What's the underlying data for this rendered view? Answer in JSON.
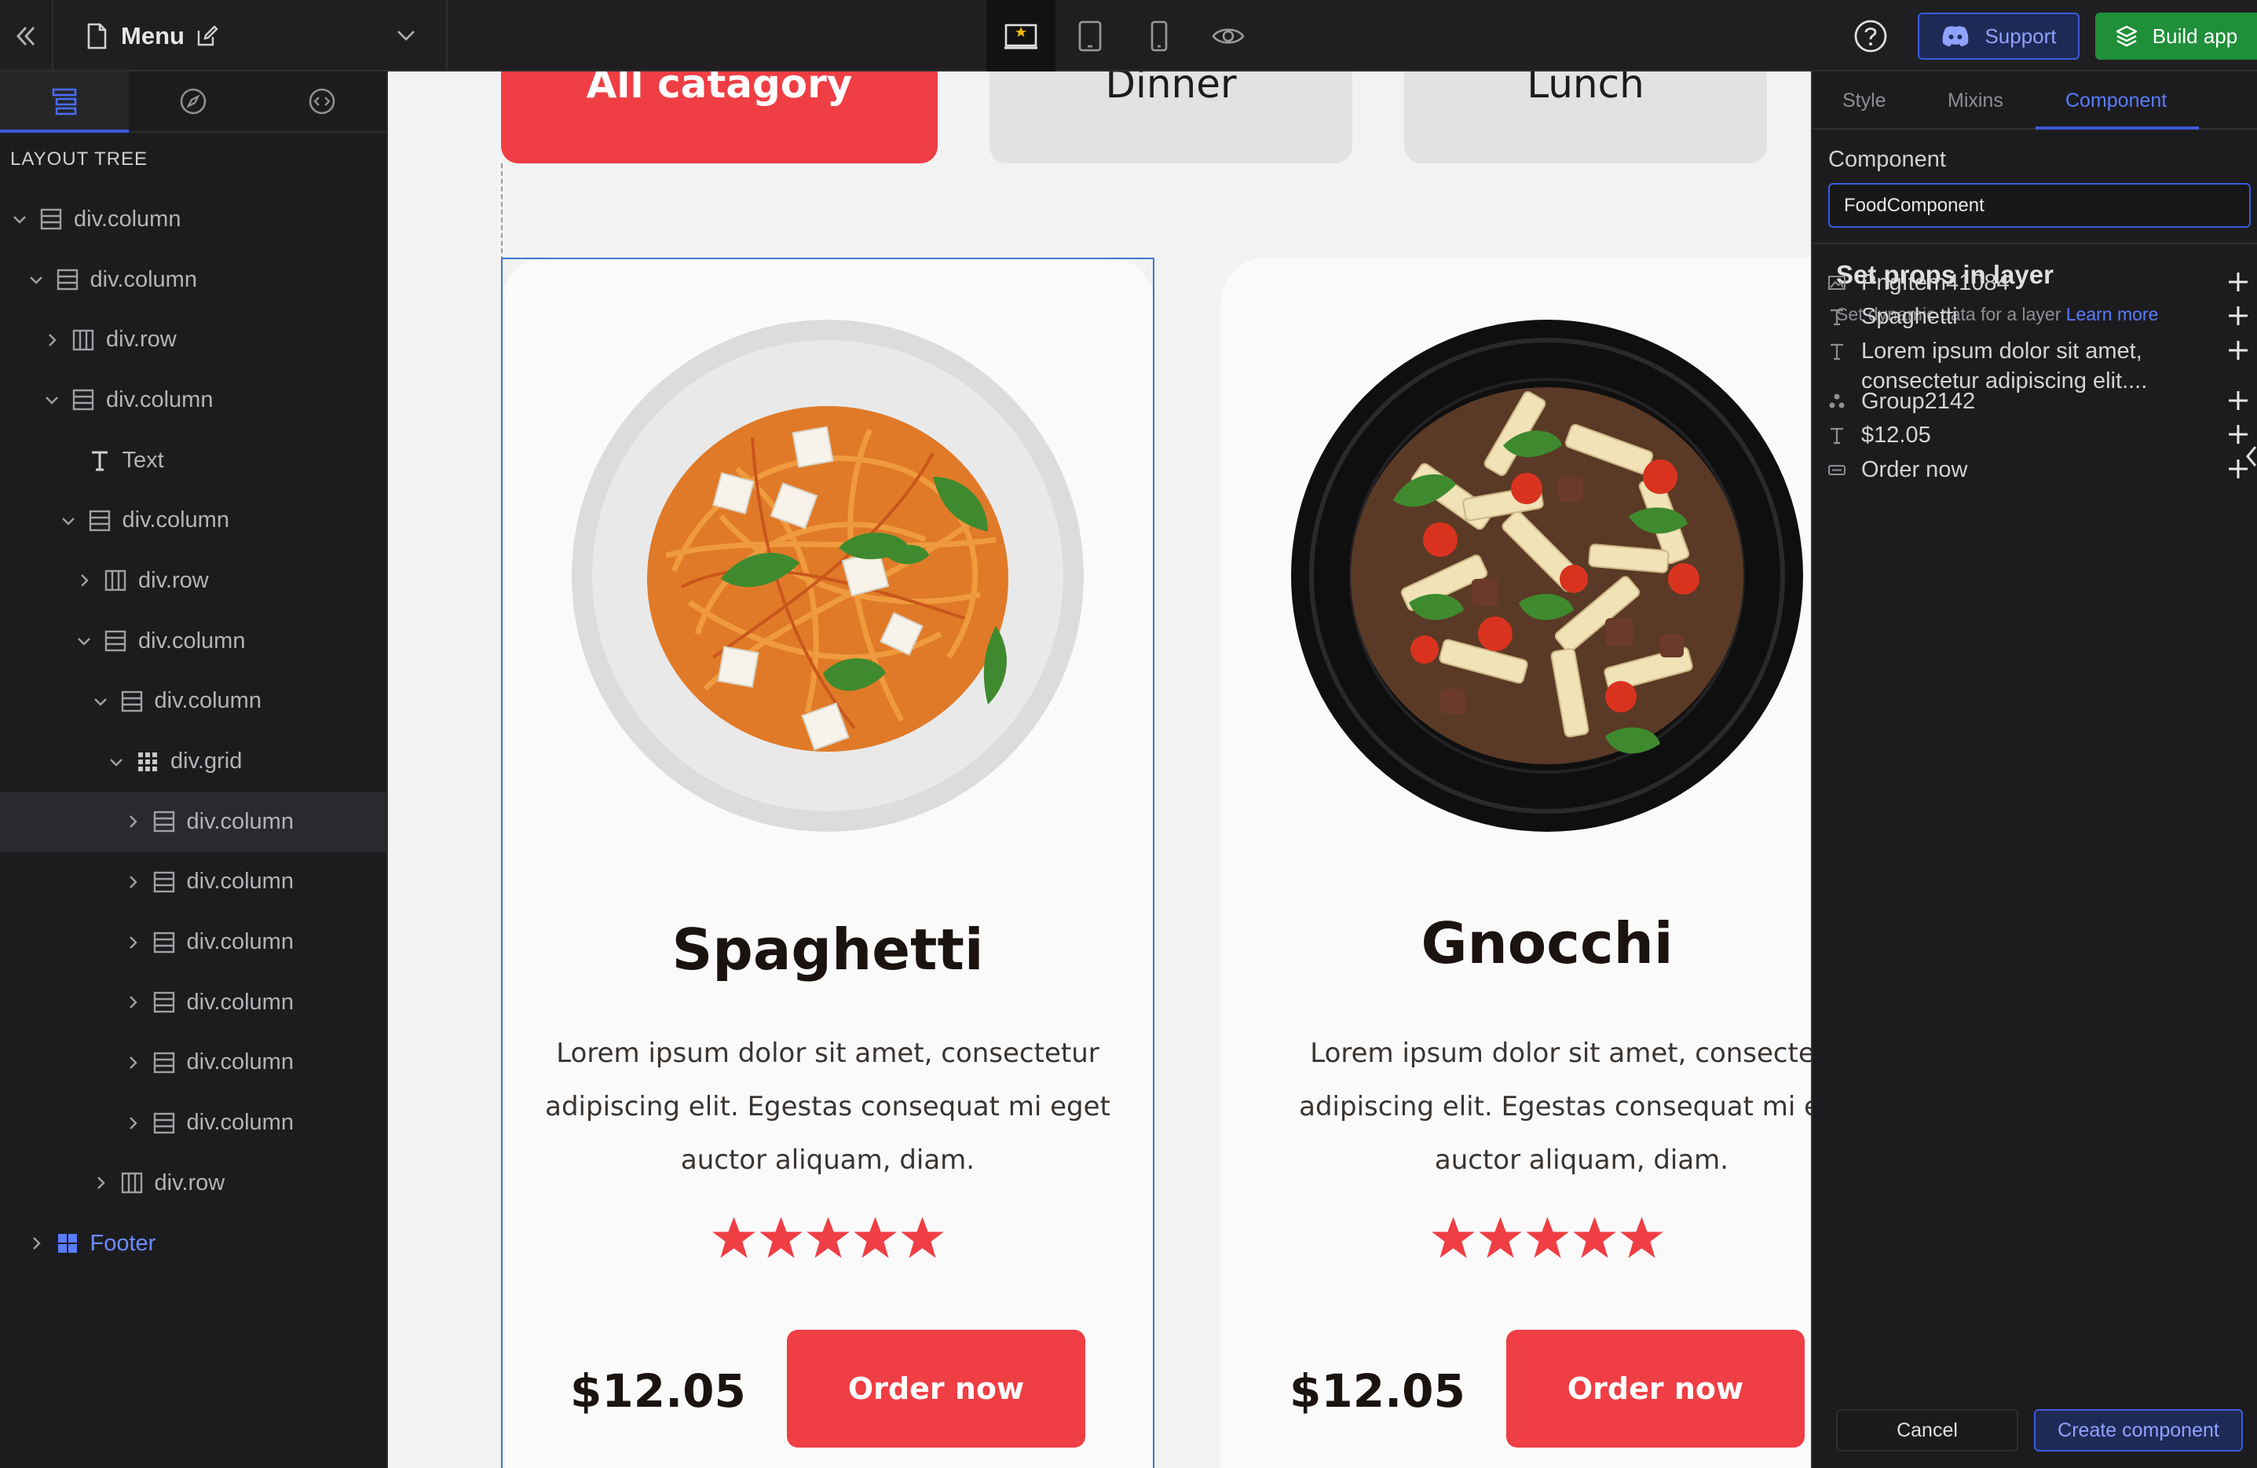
{
  "topbar": {
    "page_title": "Menu",
    "support_label": "Support",
    "build_label": "Build app"
  },
  "left_panel": {
    "heading": "LAYOUT TREE",
    "tree": [
      {
        "label": "div.column",
        "icon": "column-icon",
        "depth": 0,
        "expanded": true
      },
      {
        "label": "div.column",
        "icon": "column-icon",
        "depth": 1,
        "expanded": true
      },
      {
        "label": "div.row",
        "icon": "row-icon",
        "depth": 2,
        "expanded": false
      },
      {
        "label": "div.column",
        "icon": "column-icon",
        "depth": 2,
        "expanded": true
      },
      {
        "label": "Text",
        "icon": "text-icon",
        "depth": 3,
        "expanded": null
      },
      {
        "label": "div.column",
        "icon": "column-icon",
        "depth": 3,
        "expanded": true
      },
      {
        "label": "div.row",
        "icon": "row-icon",
        "depth": 4,
        "expanded": false
      },
      {
        "label": "div.column",
        "icon": "column-icon",
        "depth": 4,
        "expanded": true
      },
      {
        "label": "div.column",
        "icon": "column-icon",
        "depth": 5,
        "expanded": true
      },
      {
        "label": "div.grid",
        "icon": "grid-icon",
        "depth": 6,
        "expanded": true
      },
      {
        "label": "div.column",
        "icon": "column-icon",
        "depth": 7,
        "expanded": false,
        "selected": true
      },
      {
        "label": "div.column",
        "icon": "column-icon",
        "depth": 7,
        "expanded": false
      },
      {
        "label": "div.column",
        "icon": "column-icon",
        "depth": 7,
        "expanded": false
      },
      {
        "label": "div.column",
        "icon": "column-icon",
        "depth": 7,
        "expanded": false
      },
      {
        "label": "div.column",
        "icon": "column-icon",
        "depth": 7,
        "expanded": false
      },
      {
        "label": "div.column",
        "icon": "column-icon",
        "depth": 7,
        "expanded": false
      },
      {
        "label": "div.row",
        "icon": "row-icon",
        "depth": 5,
        "expanded": false
      },
      {
        "label": "Footer",
        "icon": "component-icon",
        "depth": 1,
        "expanded": false,
        "footer": true
      }
    ]
  },
  "canvas": {
    "categories": {
      "active": "All catagory",
      "dinner": "Dinner",
      "lunch": "Lunch"
    },
    "cards": [
      {
        "title": "Spaghetti",
        "desc": "Lorem ipsum dolor sit amet, consectetur adipiscing elit. Egestas consequat mi eget auctor aliquam, diam.",
        "rating": 5,
        "price": "$12.05",
        "button": "Order now"
      },
      {
        "title": "Gnocchi",
        "desc": "Lorem ipsum dolor sit amet, consectetur adipiscing elit. Egestas consequat mi eget auctor aliquam, diam.",
        "rating": 5,
        "price": "$12.05",
        "button": "Order now"
      }
    ]
  },
  "right_panel": {
    "tabs": [
      "Style",
      "Mixins",
      "Component"
    ],
    "active_tab": "Component",
    "component_label": "Component",
    "component_value": "FoodComponent",
    "props_title": "Set props in layer",
    "props_subtitle": "Set dynamic data for a layer",
    "learn_more": "Learn more",
    "props": [
      {
        "label": "PngItem41084",
        "icon": "image-icon"
      },
      {
        "label": "Spaghetti",
        "icon": "text-icon"
      },
      {
        "label": "Lorem ipsum dolor sit amet, consectetur adipiscing elit....",
        "icon": "text-icon"
      },
      {
        "label": "Group2142",
        "icon": "group-icon"
      },
      {
        "label": "$12.05",
        "icon": "text-icon"
      },
      {
        "label": "Order now",
        "icon": "button-icon"
      }
    ],
    "cancel_label": "Cancel",
    "create_label": "Create component"
  },
  "colors": {
    "accent": "#3b5bdb",
    "brand_red": "#ef3e44",
    "build_green": "#1f8f3a"
  }
}
